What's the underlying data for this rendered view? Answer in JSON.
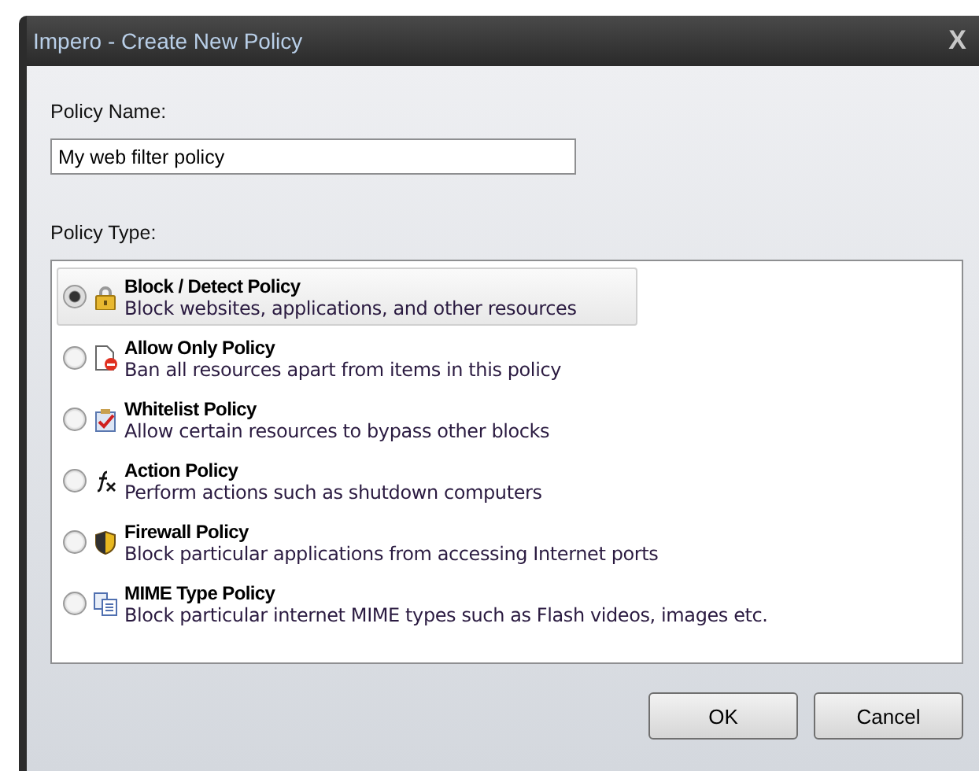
{
  "window": {
    "title": "Impero - Create New Policy",
    "close": "X"
  },
  "policy_name": {
    "label": "Policy Name:",
    "value": "My web filter policy"
  },
  "policy_type": {
    "label": "Policy Type:",
    "options": [
      {
        "title": "Block / Detect Policy",
        "description": "Block websites, applications, and other resources",
        "selected": true
      },
      {
        "title": "Allow Only Policy",
        "description": "Ban all resources apart from items in this policy",
        "selected": false
      },
      {
        "title": "Whitelist Policy",
        "description": "Allow certain resources to bypass other blocks",
        "selected": false
      },
      {
        "title": "Action Policy",
        "description": "Perform actions such as shutdown computers",
        "selected": false
      },
      {
        "title": "Firewall Policy",
        "description": "Block particular applications from accessing Internet ports",
        "selected": false
      },
      {
        "title": "MIME Type Policy",
        "description": "Block particular internet MIME types such as Flash videos, images etc.",
        "selected": false
      }
    ]
  },
  "buttons": [
    "OK",
    "Cancel"
  ]
}
